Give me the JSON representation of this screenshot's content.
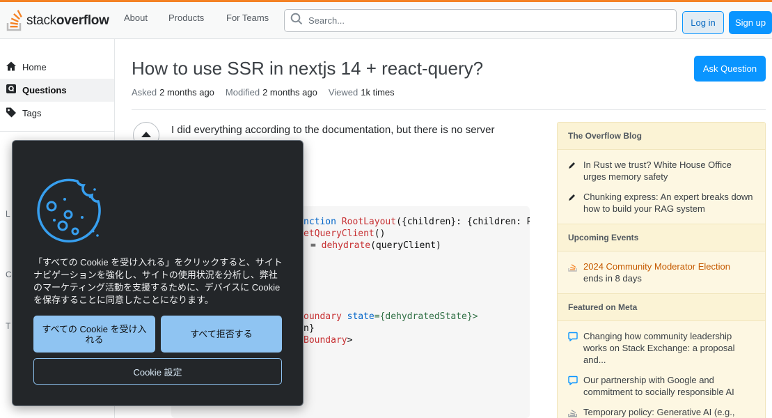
{
  "header": {
    "logo_text_light": "stack",
    "logo_text_bold": "overflow",
    "nav": [
      "About",
      "Products",
      "For Teams"
    ],
    "search_placeholder": "Search...",
    "login_label": "Log in",
    "signup_label": "Sign up",
    "accent_color": "#f48225"
  },
  "sidebar_left": {
    "items": [
      {
        "label": "Home",
        "icon": "home-icon"
      },
      {
        "label": "Questions",
        "icon": "questions-icon",
        "active": true
      },
      {
        "label": "Tags",
        "icon": "tag-icon"
      }
    ],
    "peek_letters": [
      "L",
      "C",
      "T"
    ]
  },
  "question": {
    "title": "How to use SSR in nextjs 14 + react-query?",
    "asked_label": "Asked",
    "asked_value": "2 months ago",
    "modified_label": "Modified",
    "modified_value": "2 months ago",
    "viewed_label": "Viewed",
    "viewed_value": "1k times",
    "ask_button": "Ask Question",
    "body_first_line": "I did everything according to the documentation, but there is no server"
  },
  "code": {
    "lines": [
      [
        "nction ",
        "RootLayout",
        "({children}: {children: ",
        "R"
      ],
      [
        "etQueryClient",
        "()"
      ],
      [
        "= ",
        "dehydrate",
        "(queryClient)"
      ],
      [
        "oundary ",
        "state",
        "={dehydratedState}>"
      ],
      [
        "n}"
      ],
      [
        "Boundary",
        ">"
      ]
    ]
  },
  "right_sidebar": {
    "blog_heading": "The Overflow Blog",
    "blog_items": [
      "In Rust we trust? White House Office urges memory safety",
      "Chunking express: An expert breaks down how to build your RAG system"
    ],
    "events_heading": "Upcoming Events",
    "event_link": "2024 Community Moderator Election",
    "event_sub": "ends in 8 days",
    "meta_heading": "Featured on Meta",
    "meta_items": [
      "Changing how community leadership works on Stack Exchange: a proposal and...",
      "Our partnership with Google and commitment to socially responsible AI",
      "Temporary policy: Generative AI (e.g.,"
    ]
  },
  "cookie_dialog": {
    "text": "「すべての Cookie を受け入れる」をクリックすると、サイトナビゲーションを強化し、サイトの使用状況を分析し、弊社のマーケティング活動を支援するために、デバイスに Cookie を保存することに同意したことになります。",
    "accept_all": "すべての Cookie を受け入れる",
    "reject_all": "すべて拒否する",
    "settings": "Cookie 設定"
  }
}
